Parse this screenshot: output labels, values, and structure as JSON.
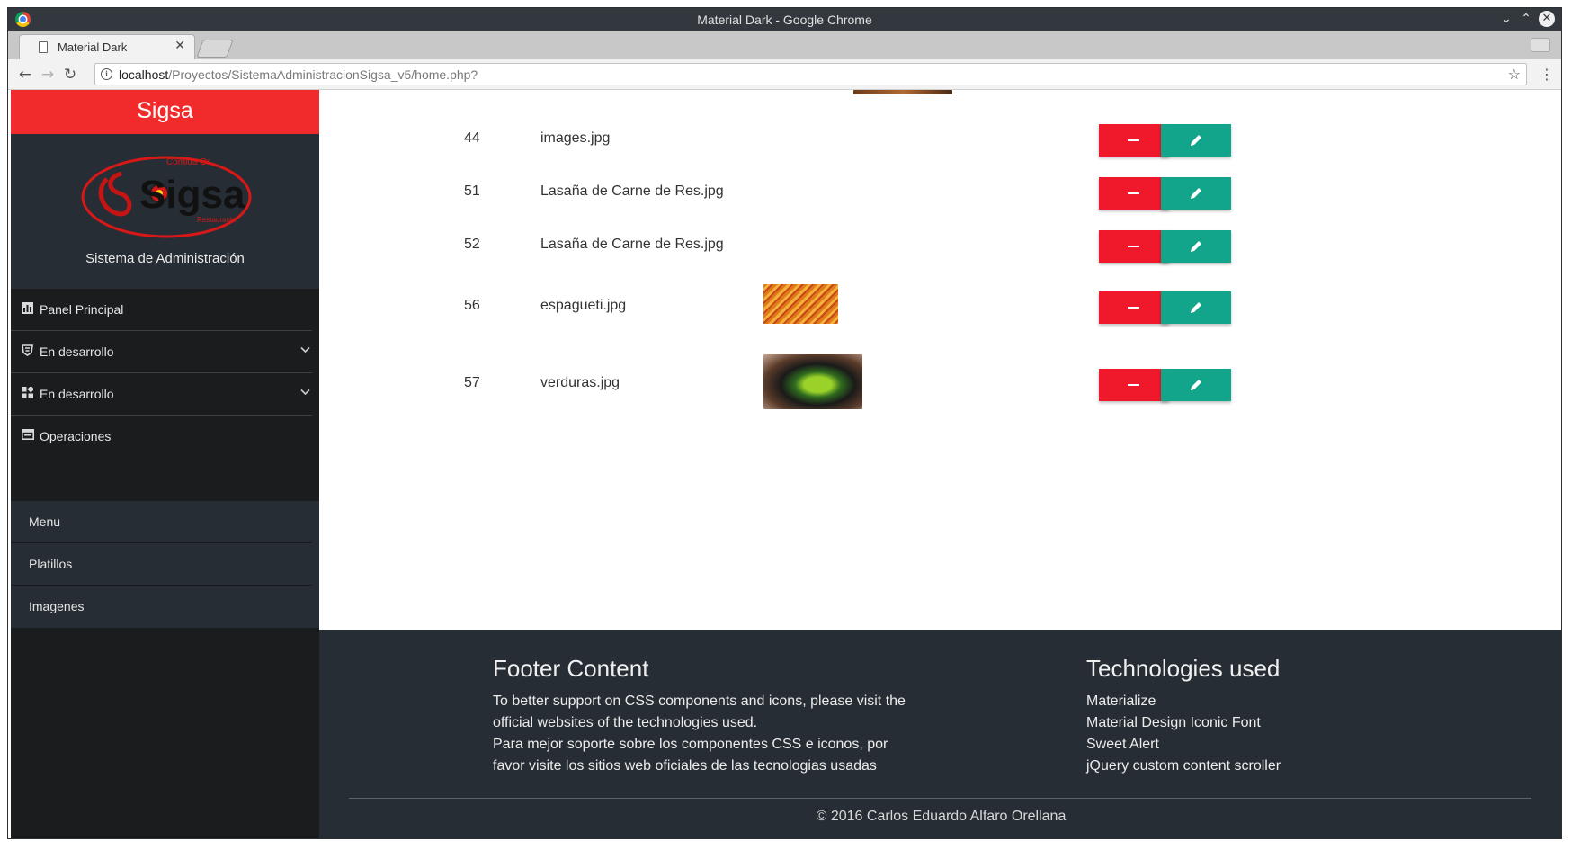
{
  "window": {
    "title": "Material Dark - Google Chrome",
    "tab_title": "Material Dark",
    "url_host": "localhost",
    "url_path": "/Proyectos/SistemaAdministracionSigsa_v5/home.php?"
  },
  "sidebar": {
    "brand": "Sigsa",
    "logo_text": "Sigsa",
    "logo_top_text": "Comida Or",
    "logo_bottom_text": "Restaurante",
    "caption": "Sistema de Administración",
    "items": [
      {
        "label": "Panel Principal",
        "icon": "chart-icon"
      },
      {
        "label": "En desarrollo",
        "icon": "css-icon"
      },
      {
        "label": "En desarrollo",
        "icon": "widgets-icon"
      },
      {
        "label": "Operaciones",
        "icon": "window-icon"
      }
    ],
    "subitems": [
      "Menu",
      "Platillos",
      "Imagenes"
    ]
  },
  "table": {
    "rows": [
      {
        "id": "44",
        "name": "images.jpg"
      },
      {
        "id": "51",
        "name": "Lasaña de Carne de Res.jpg"
      },
      {
        "id": "52",
        "name": "Lasaña de Carne de Res.jpg"
      },
      {
        "id": "56",
        "name": "espagueti.jpg"
      },
      {
        "id": "57",
        "name": "verduras.jpg"
      }
    ]
  },
  "footer": {
    "content_title": "Footer Content",
    "content_lines": [
      "To better support on CSS components and icons, please visit the",
      "official websites of the technologies used.",
      "Para mejor soporte sobre los componentes CSS e iconos, por",
      "favor visite los sitios web oficiales de las tecnologias usadas"
    ],
    "tech_title": "Technologies used",
    "tech_items": [
      "Materialize",
      "Material Design Iconic Font",
      "Sweet Alert",
      "jQuery custom content scroller"
    ],
    "copyright": "© 2016 Carlos Eduardo Alfaro Orellana"
  },
  "colors": {
    "brand_red": "#f12b2b",
    "delete_red": "#f0182b",
    "edit_teal": "#13a58c",
    "dark_bg": "#262d34"
  }
}
